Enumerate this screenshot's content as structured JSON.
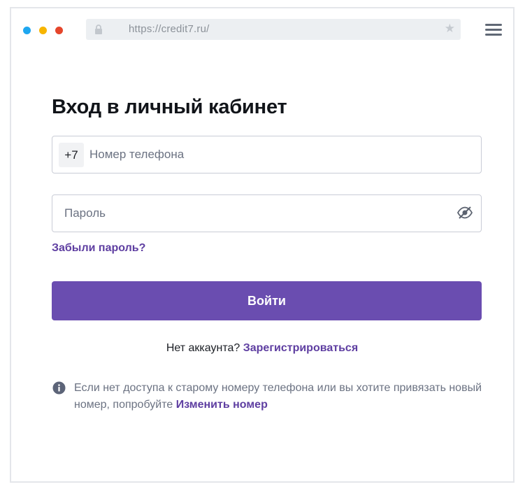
{
  "browser": {
    "url": "https://credit7.ru/",
    "icons": [
      "lock-icon",
      "star-icon",
      "hamburger-menu-icon"
    ]
  },
  "form": {
    "title": "Вход в личный кабинет",
    "phone_prefix": "+7",
    "phone_placeholder": "Номер телефона",
    "password_placeholder": "Пароль",
    "forgot_label": "Забыли пароль?",
    "submit_label": "Войти"
  },
  "register": {
    "prompt": "Нет аккаунта?",
    "link_label": "Зарегистрироваться"
  },
  "info": {
    "text": "Если нет доступа к старому номеру телефона или вы хотите привязать новый номер, попробуйте",
    "link_label": "Изменить номер"
  },
  "colors": {
    "accent": "#6a4db0",
    "link": "#5e3ea1",
    "dot_blue": "#1ea7f0",
    "dot_yellow": "#f7b500",
    "dot_red": "#e5462b"
  }
}
